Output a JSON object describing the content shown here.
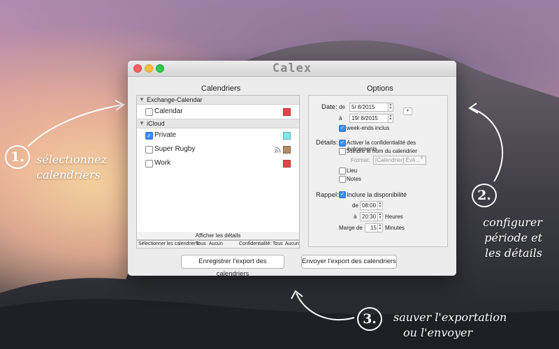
{
  "window": {
    "title": "Calex"
  },
  "left_pane": {
    "title": "Calendriers",
    "groups": [
      {
        "name": "Exchange-Calendar",
        "items": [
          {
            "label": "Calendar",
            "checked": false,
            "color": "#e8434b"
          }
        ]
      },
      {
        "name": "iCloud",
        "items": [
          {
            "label": "Private",
            "checked": true,
            "color": "#7de8ee"
          },
          {
            "label": "Super Rugby",
            "checked": false,
            "color": "#b08c6a",
            "icon": "rss-icon"
          },
          {
            "label": "Work",
            "checked": false,
            "color": "#e8434b"
          }
        ]
      }
    ],
    "details_button": "Afficher les détails",
    "select_label": "Sélectionner les calendriers:",
    "all": "Tous",
    "none": "Aucun",
    "confidentiality_label": "Confidentialité:"
  },
  "right_pane": {
    "title": "Options",
    "date_label": "Date:",
    "from_label": "de",
    "from_value": "5/ 8/2015",
    "to_label": "à",
    "to_value": "19/ 8/2015",
    "weekends": "week-ends inclus",
    "details_label": "Détails:",
    "privacy": "Activer la confidentialité des évènements",
    "join_name": "Joindre le nom du calendrier",
    "format_label": "Format:",
    "format_value": "[Calendrier] Évè...",
    "lieu": "Lieu",
    "notes": "Notes",
    "rappel_label": "Rappel:",
    "availability": "Inclure la disponibilité",
    "de_label": "de",
    "de_time": "08:00",
    "a_label": "à",
    "a_time": "20:30",
    "heures": "Heures",
    "marge_label": "Marge de",
    "marge_value": "15",
    "minutes": "Minutes"
  },
  "buttons": {
    "save": "Enregistrer l'export des calendriers",
    "send": "Envoyer l'export des calendriers"
  },
  "annotations": {
    "step1_num": "1.",
    "step1_line1": "sélectionnez",
    "step1_line2": "calendriers",
    "step2_num": "2.",
    "step2_line1": "configurer",
    "step2_line2": "période et",
    "step2_line3": "les détails",
    "step3_num": "3.",
    "step3_line1": "sauver l'exportation",
    "step3_line2": "ou l'envoyer"
  },
  "colors": {
    "accent": "#3b8cf4",
    "red": "#e8434b",
    "cyan": "#7de8ee",
    "brown": "#b08c6a"
  }
}
